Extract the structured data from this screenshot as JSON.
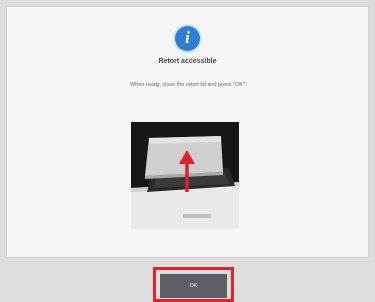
{
  "dialog": {
    "title": "Retort accessible",
    "message": "When ready, close the retort lid and press \"OK\"",
    "icon": "info-icon",
    "ok_label": "OK"
  },
  "colors": {
    "icon": "#2d7fd0",
    "highlight": "#e0212e",
    "button": "#5c5f66"
  }
}
